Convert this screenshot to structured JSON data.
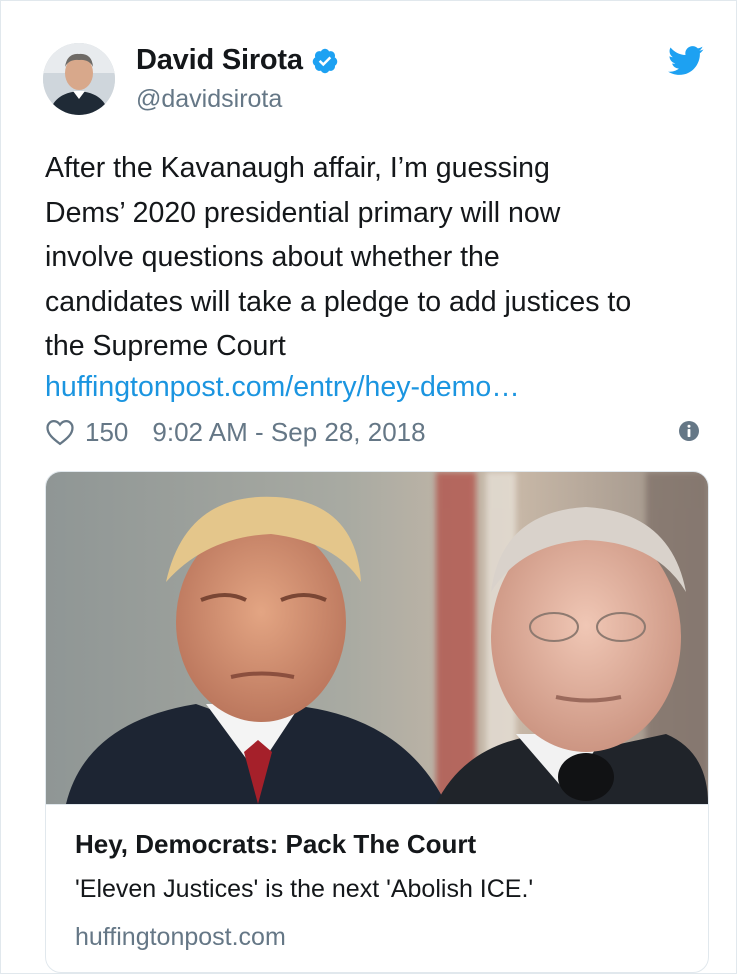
{
  "tweet": {
    "author": {
      "display_name": "David Sirota",
      "handle": "@davidsirota",
      "verified": true,
      "avatar_icon": "profile-photo"
    },
    "brand_icon": "twitter-bird-icon",
    "text_lines": [
      "After the Kavanaugh affair, I’m guessing",
      "Dems’ 2020 presidential primary will now",
      "involve questions about whether the",
      "candidates will take a pledge to add justices to",
      "the Supreme Court"
    ],
    "link_text": "huffingtonpost.com/entry/hey-demo…",
    "likes": "150",
    "timestamp": "9:02 AM - Sep 28, 2018"
  },
  "card": {
    "title": "Hey, Democrats: Pack The Court",
    "description": "'Eleven Justices' is the next 'Abolish ICE.'",
    "domain": "huffingtonpost.com"
  },
  "colors": {
    "link": "#1b95e0",
    "secondary_text": "#657786",
    "border": "#e1e8ed",
    "twitter_blue": "#1da1f2"
  }
}
